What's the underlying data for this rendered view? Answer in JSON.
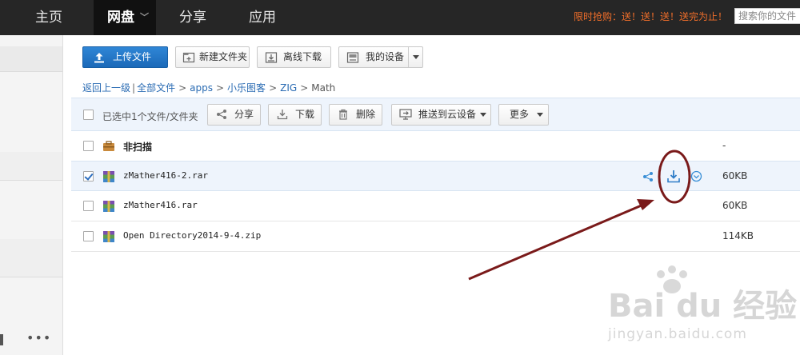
{
  "nav": {
    "items": [
      {
        "label": "主页"
      },
      {
        "label": "网盘"
      },
      {
        "label": "分享"
      },
      {
        "label": "应用"
      }
    ],
    "promo": "限时抢购：送！送！送！送完为止！",
    "search_placeholder": "搜索你的文件"
  },
  "toolbar": {
    "upload": "上传文件",
    "new_folder": "新建文件夹",
    "offline_download": "离线下载",
    "my_devices": "我的设备"
  },
  "breadcrumb": {
    "back": "返回上一级",
    "crumbs": [
      "全部文件",
      "apps",
      "小乐图客",
      "ZIG",
      "Math"
    ]
  },
  "selection": {
    "text": "已选中1个文件/文件夹",
    "share": "分享",
    "download": "下载",
    "delete": "删除",
    "push": "推送到云设备",
    "more": "更多"
  },
  "files": [
    {
      "name": "非扫描",
      "size": "-",
      "type": "folder",
      "checked": false
    },
    {
      "name": "zMather416-2.rar",
      "size": "60KB",
      "type": "archive",
      "checked": true
    },
    {
      "name": "zMather416.rar",
      "size": "60KB",
      "type": "archive",
      "checked": false
    },
    {
      "name": "Open Directory2014-9-4.zip",
      "size": "114KB",
      "type": "archive",
      "checked": false
    }
  ],
  "row_actions": [
    "share-icon",
    "download-icon",
    "more-circle-icon"
  ],
  "colors": {
    "accent": "#2a6bb3",
    "primary_button": "#1f74c4",
    "promo": "#f06e2a",
    "annotation": "#7a1a1a"
  },
  "watermark": {
    "brand": "Bai du 经验",
    "url": "jingyan.baidu.com"
  }
}
